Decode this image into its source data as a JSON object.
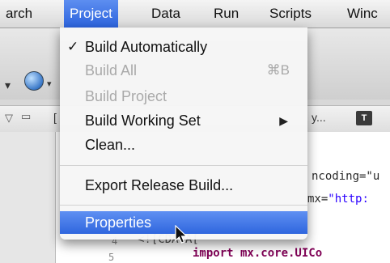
{
  "menubar": {
    "items": [
      {
        "label": "arch"
      },
      {
        "label": "Project"
      },
      {
        "label": "Data"
      },
      {
        "label": "Run"
      },
      {
        "label": "Scripts"
      },
      {
        "label": "Winc"
      }
    ]
  },
  "project_menu": {
    "build_automatically": {
      "label": "Build Automatically",
      "check": "✓"
    },
    "build_all": {
      "label": "Build All",
      "shortcut": "⌘B"
    },
    "build_project": {
      "label": "Build Project"
    },
    "build_working_set": {
      "label": "Build Working Set",
      "submenu_arrow": "▶"
    },
    "clean": {
      "label": "Clean..."
    },
    "export_release_build": {
      "label": "Export Release Build..."
    },
    "properties": {
      "label": "Properties"
    }
  },
  "background": {
    "view_bar_text": "y...",
    "view_bar_b": "[",
    "code_line_1": "ncoding=\"u",
    "code_line_2_a": "mx=",
    "code_line_2_b": "\"http:",
    "code_line_3": "<![CDATA[",
    "code_line_4": "import mx.core.UICo",
    "line_numbers": [
      "4",
      "5"
    ]
  },
  "colors": {
    "highlight": "#2f66de",
    "disabled_text": "#a9a9a9"
  }
}
